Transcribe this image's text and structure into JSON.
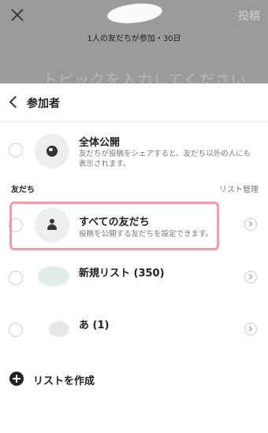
{
  "composer": {
    "participants_summary": "1人の友だちが参加・30日",
    "post_label": "投稿",
    "topic_placeholder": "トピックを入力してください"
  },
  "sheet": {
    "title": "参加者",
    "public": {
      "title": "全体公開",
      "description": "友だちが投稿をシェアすると、友だち以外の人にも表示されます。",
      "icon": "globe-icon"
    },
    "friends_section": {
      "label": "友だち",
      "manage_label": "リスト管理"
    },
    "lists": [
      {
        "title": "すべての友だち",
        "subtitle": "投稿を公開する友だちを設定できます。",
        "icon": "person-icon"
      },
      {
        "title": "新規リスト (350)",
        "subtitle": ""
      },
      {
        "title": "あ (1)",
        "subtitle": ""
      }
    ],
    "create_list_label": "リストを作成"
  },
  "colors": {
    "backdrop": "#9b9b9b",
    "highlight": "#f07a8c",
    "text": "#222222",
    "muted": "#777777"
  }
}
